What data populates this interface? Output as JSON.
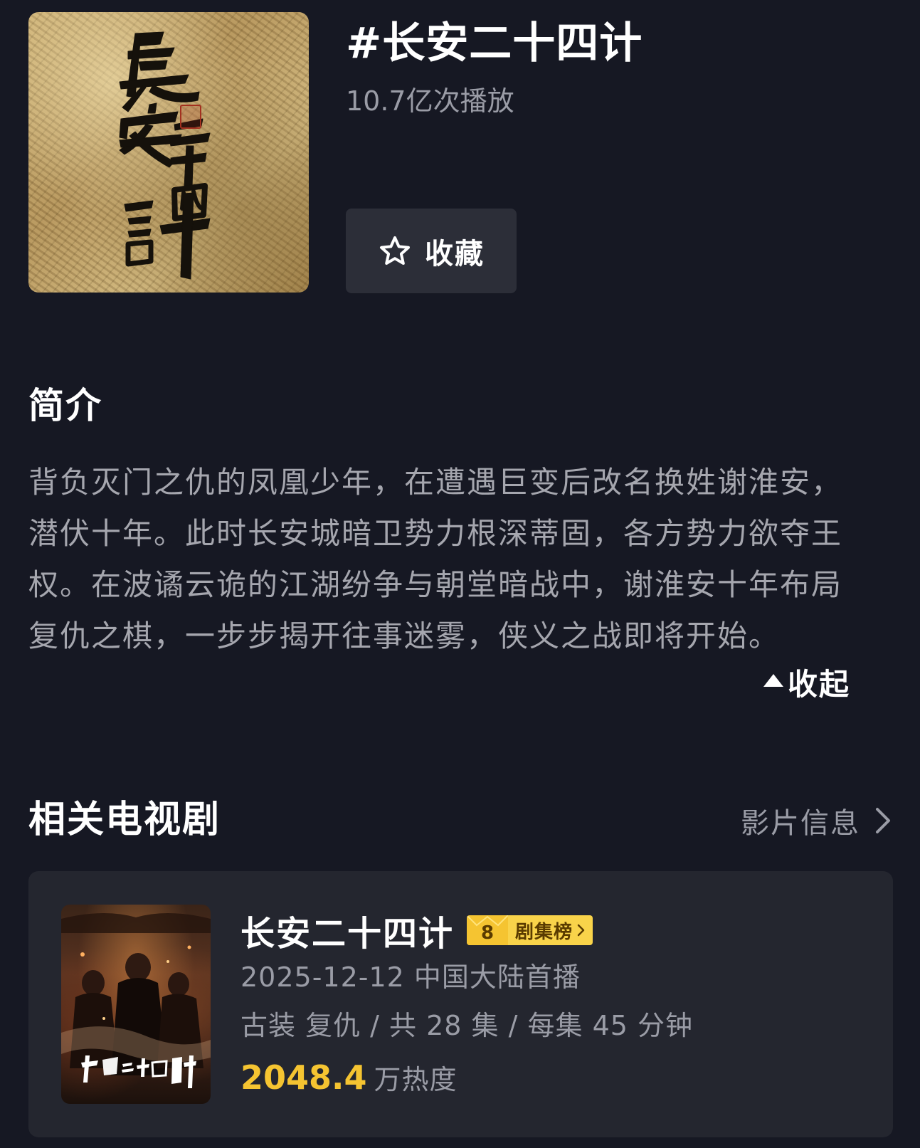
{
  "topic": {
    "title": "#长安二十四计",
    "plays": "10.7亿次播放",
    "favorite_label": "收藏",
    "cover_icon": "calligraphy-cover-image",
    "cover_lettering": "長安二十四計"
  },
  "intro": {
    "heading": "简介",
    "lines": [
      "背负灭门之仇的凤凰少年，在遭遇巨变后改名换姓谢淮安，",
      "潜伏十年。此时长安城暗卫势力根深蒂固，各方势力欲夺王",
      "权。在波谲云诡的江湖纷争与朝堂暗战中，谢淮安十年布局",
      "复仇之棋，一步步揭开往事迷雾，侠义之战即将开始。"
    ],
    "collapse_label": "收起"
  },
  "related": {
    "heading": "相关电视剧",
    "info_link_label": "影片信息",
    "drama": {
      "title": "长安二十四计",
      "rank_number": "8",
      "rank_label": "剧集榜",
      "premiere": "2025-12-12 中国大陆首播",
      "meta": "古装 复仇 / 共 28 集 / 每集 45 分钟",
      "heat_value": "2048.4",
      "heat_unit": "万热度",
      "poster_lettering": "長安二十四計"
    }
  },
  "colors": {
    "background": "#161823",
    "card": "#24262f",
    "button": "#2c2e38",
    "muted_text": "#9a9ca6",
    "accent_gold": "#f5c431"
  }
}
